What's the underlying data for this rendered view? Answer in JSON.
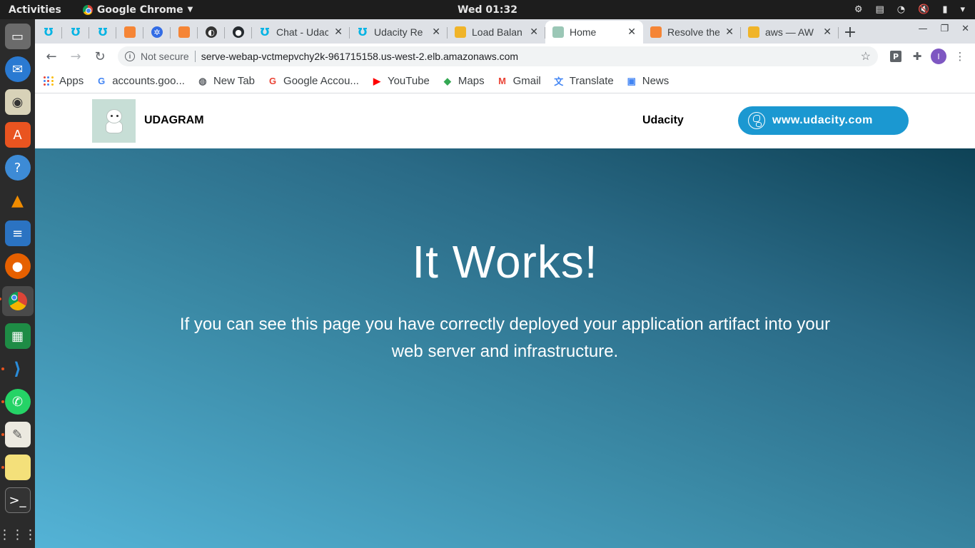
{
  "system": {
    "activities": "Activities",
    "app_name": "Google Chrome",
    "clock": "Wed 01:32"
  },
  "tabs": {
    "pinned_icons": [
      "udacity-icon",
      "udacity-icon",
      "udacity-icon",
      "aws-icon",
      "kubernetes-icon",
      "aws-icon",
      "dark-circle-icon",
      "github-icon"
    ],
    "items": [
      {
        "title": "Chat - Udac",
        "icon": "udacity-icon"
      },
      {
        "title": "Udacity Re",
        "icon": "udacity-icon"
      },
      {
        "title": "Load Balan",
        "icon": "aws-box-icon"
      },
      {
        "title": "Home",
        "icon": "udagram-icon",
        "active": true
      },
      {
        "title": "Resolve the",
        "icon": "aws-icon"
      },
      {
        "title": "aws — AW",
        "icon": "aws-box-icon"
      }
    ],
    "new_tab": "+"
  },
  "toolbar": {
    "security": "Not secure",
    "url": "serve-webap-vctmepvchy2k-961715158.us-west-2.elb.amazonaws.com",
    "avatar_letter": "I",
    "ext_p": "P"
  },
  "bookmarks": [
    {
      "label": "Apps",
      "icon": "apps-grid-icon"
    },
    {
      "label": "accounts.goo...",
      "icon": "google-icon"
    },
    {
      "label": "New Tab",
      "icon": "globe-icon"
    },
    {
      "label": "Google Accou...",
      "icon": "google-icon"
    },
    {
      "label": "YouTube",
      "icon": "youtube-icon"
    },
    {
      "label": "Maps",
      "icon": "maps-icon"
    },
    {
      "label": "Gmail",
      "icon": "gmail-icon"
    },
    {
      "label": "Translate",
      "icon": "translate-icon"
    },
    {
      "label": "News",
      "icon": "news-icon"
    }
  ],
  "site": {
    "brand": "UDAGRAM",
    "nav_link": "Udacity",
    "cta": "www.udacity.com",
    "hero_title": "It Works!",
    "hero_text": "If you can see this page you have correctly deployed your application artifact into your web server and infrastructure."
  },
  "colors": {
    "cta": "#1b98d1",
    "hero_dark": "#0e4256",
    "hero_light": "#54b3d6",
    "ubuntu_accent": "#e95420"
  }
}
